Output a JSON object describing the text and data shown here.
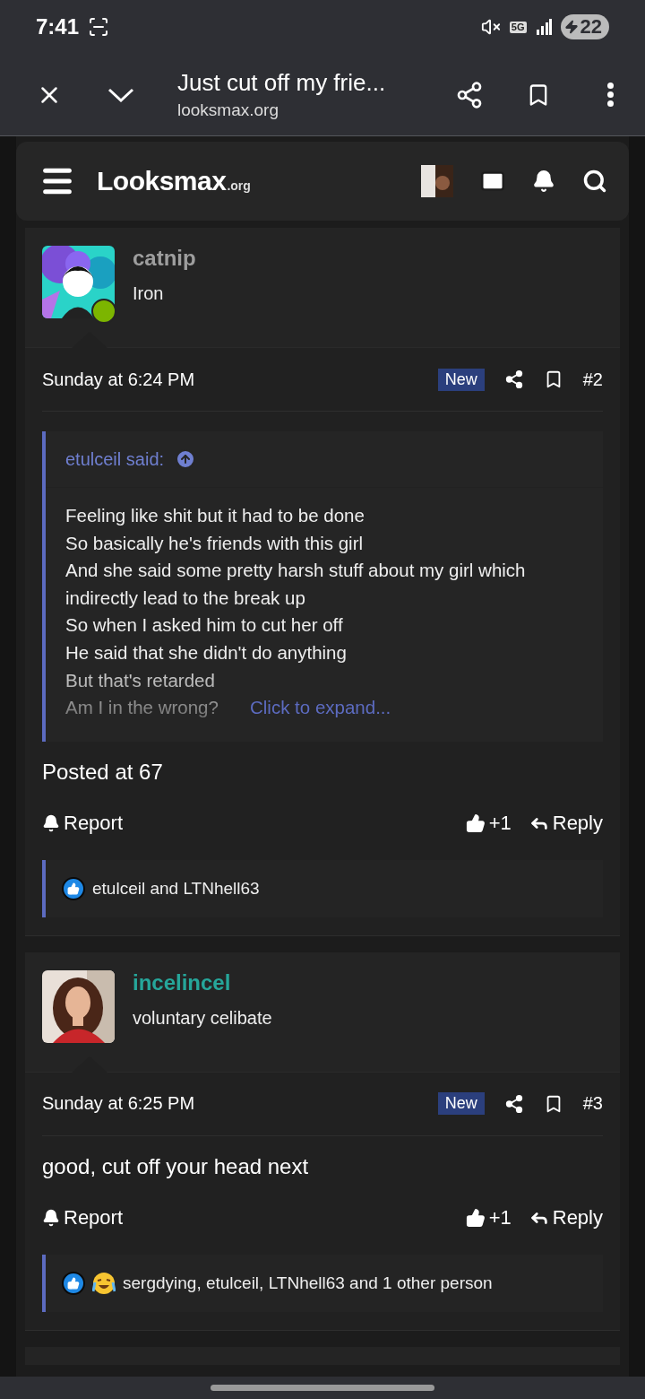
{
  "status_bar": {
    "time": "7:41",
    "network": "5G",
    "battery": "22"
  },
  "browser": {
    "title": "Just cut off my frie...",
    "url": "looksmax.org"
  },
  "site": {
    "logo": "Looksmax",
    "logo_suffix": ".org"
  },
  "posts": [
    {
      "username": "catnip",
      "color": "#9e9e9e",
      "title": "Iron",
      "online": true,
      "date": "Sunday at 6:24 PM",
      "badge": "New",
      "number": "#2",
      "quote": {
        "author": "etulceil said:",
        "collapsed": true,
        "lines": [
          "Feeling like shit but it had to be done",
          "So basically he's friends with this girl",
          "And she said some pretty harsh stuff about my girl which indirectly lead to the break up",
          "So when I asked him to cut her off",
          "He said that she didn't do anything",
          "But that's retarded",
          "Am I in the wrong?"
        ],
        "expand": "Click to expand..."
      },
      "body": "Posted at 67",
      "report": "Report",
      "likes": "+1",
      "reply": "Reply",
      "reactions": {
        "icons": [
          {
            "kind": "like"
          }
        ],
        "text": "etulceil and LTNhell63"
      }
    },
    {
      "username": "incelincel",
      "color": "#26a69a",
      "title": "voluntary celibate",
      "online": false,
      "date": "Sunday at 6:25 PM",
      "badge": "New",
      "number": "#3",
      "body": "good, cut off your head next",
      "report": "Report",
      "likes": "+1",
      "reply": "Reply",
      "reactions": {
        "icons": [
          {
            "kind": "like"
          },
          {
            "kind": "haha"
          }
        ],
        "text": "sergdying, etulceil, LTNhell63 and 1 other person"
      }
    }
  ]
}
